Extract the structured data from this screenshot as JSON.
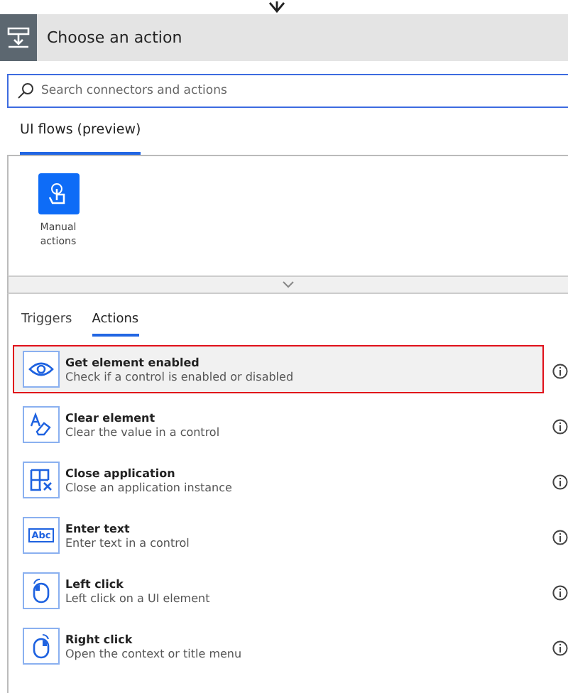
{
  "header": {
    "title": "Choose an action"
  },
  "search": {
    "placeholder": "Search connectors and actions"
  },
  "connector_tabs": [
    {
      "label": "UI flows (preview)",
      "selected": true
    }
  ],
  "connectors": [
    {
      "label": "Manual actions",
      "selected": true
    }
  ],
  "section_tabs": [
    {
      "label": "Triggers",
      "selected": false
    },
    {
      "label": "Actions",
      "selected": true
    }
  ],
  "actions": [
    {
      "kind": "eye",
      "title": "Get element enabled",
      "description": "Check if a control is enabled or disabled",
      "selected": true
    },
    {
      "kind": "eraser",
      "title": "Clear element",
      "description": "Clear the value in a control",
      "selected": false
    },
    {
      "kind": "close-app",
      "title": "Close application",
      "description": "Close an application instance",
      "selected": false
    },
    {
      "kind": "text",
      "icon_text": "Abc",
      "title": "Enter text",
      "description": "Enter text in a control",
      "selected": false
    },
    {
      "kind": "left-click",
      "title": "Left click",
      "description": "Left click on a UI element",
      "selected": false
    },
    {
      "kind": "right-click",
      "title": "Right click",
      "description": "Open the context or title menu",
      "selected": false
    }
  ]
}
